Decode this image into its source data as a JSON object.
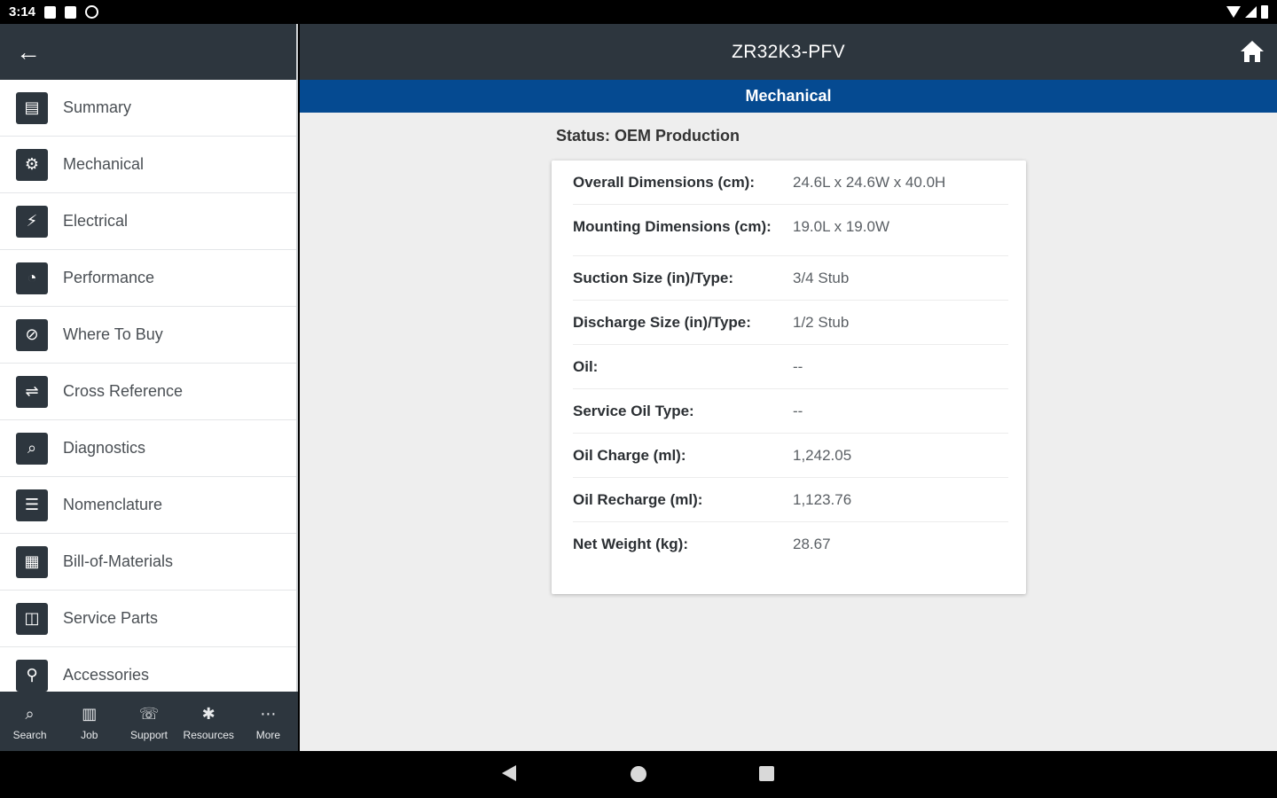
{
  "status_bar": {
    "time": "3:14"
  },
  "sidebar": {
    "items": [
      {
        "label": "Summary",
        "icon": "clipboard-icon",
        "glyph": "▤"
      },
      {
        "label": "Mechanical",
        "icon": "gear-icon",
        "glyph": "⚙"
      },
      {
        "label": "Electrical",
        "icon": "plug-icon",
        "glyph": "⚡"
      },
      {
        "label": "Performance",
        "icon": "gauge-icon",
        "glyph": "◔"
      },
      {
        "label": "Where To Buy",
        "icon": "compass-icon",
        "glyph": "⊘"
      },
      {
        "label": "Cross Reference",
        "icon": "arrows-icon",
        "glyph": "⇌"
      },
      {
        "label": "Diagnostics",
        "icon": "magnifier-icon",
        "glyph": "⌕"
      },
      {
        "label": "Nomenclature",
        "icon": "list-icon",
        "glyph": "☰"
      },
      {
        "label": "Bill-of-Materials",
        "icon": "document-icon",
        "glyph": "▦"
      },
      {
        "label": "Service Parts",
        "icon": "parts-icon",
        "glyph": "◫"
      },
      {
        "label": "Accessories",
        "icon": "accessories-icon",
        "glyph": "⚲"
      }
    ]
  },
  "bottom_nav": [
    {
      "label": "Search",
      "icon": "search-icon",
      "glyph": "⌕"
    },
    {
      "label": "Job",
      "icon": "job-icon",
      "glyph": "▥"
    },
    {
      "label": "Support",
      "icon": "support-icon",
      "glyph": "☏"
    },
    {
      "label": "Resources",
      "icon": "tools-icon",
      "glyph": "✱"
    },
    {
      "label": "More",
      "icon": "more-icon",
      "glyph": "⋯"
    }
  ],
  "header": {
    "title": "ZR32K3-PFV"
  },
  "section": {
    "title": "Mechanical"
  },
  "status_text": "Status: OEM Production",
  "specs": [
    {
      "label": "Overall Dimensions (cm):",
      "value": "24.6L x 24.6W x 40.0H"
    },
    {
      "label": "Mounting Dimensions (cm):",
      "value": "19.0L x 19.0W"
    },
    {
      "label": "Suction Size (in)/Type:",
      "value": "3/4 Stub"
    },
    {
      "label": "Discharge Size (in)/Type:",
      "value": "1/2 Stub"
    },
    {
      "label": "Oil:",
      "value": "--"
    },
    {
      "label": "Service Oil Type:",
      "value": "--"
    },
    {
      "label": "Oil Charge (ml):",
      "value": "1,242.05"
    },
    {
      "label": "Oil Recharge (ml):",
      "value": "1,123.76"
    },
    {
      "label": "Net Weight (kg):",
      "value": "28.67"
    }
  ],
  "colors": {
    "header": "#2d363e",
    "section_bar": "#054a91",
    "background": "#eeeeee"
  }
}
